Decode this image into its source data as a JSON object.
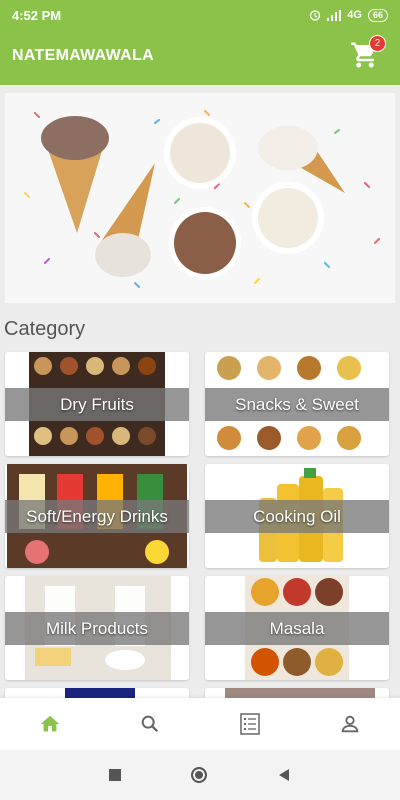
{
  "status": {
    "time": "4:52 PM",
    "network": "4G",
    "battery": "66"
  },
  "app": {
    "title": "NATEMAWAWALA",
    "cart_count": "2"
  },
  "category_heading": "Category",
  "categories": [
    {
      "label": "Dry Fruits"
    },
    {
      "label": "Snacks & Sweet"
    },
    {
      "label": "Soft/Energy Drinks"
    },
    {
      "label": "Cooking Oil"
    },
    {
      "label": "Milk Products"
    },
    {
      "label": "Masala"
    }
  ],
  "colors": {
    "primary": "#8bc34a",
    "badge": "#e53935"
  },
  "bottom_nav": [
    "home-icon",
    "search-icon",
    "orders-list-icon",
    "account-icon"
  ]
}
